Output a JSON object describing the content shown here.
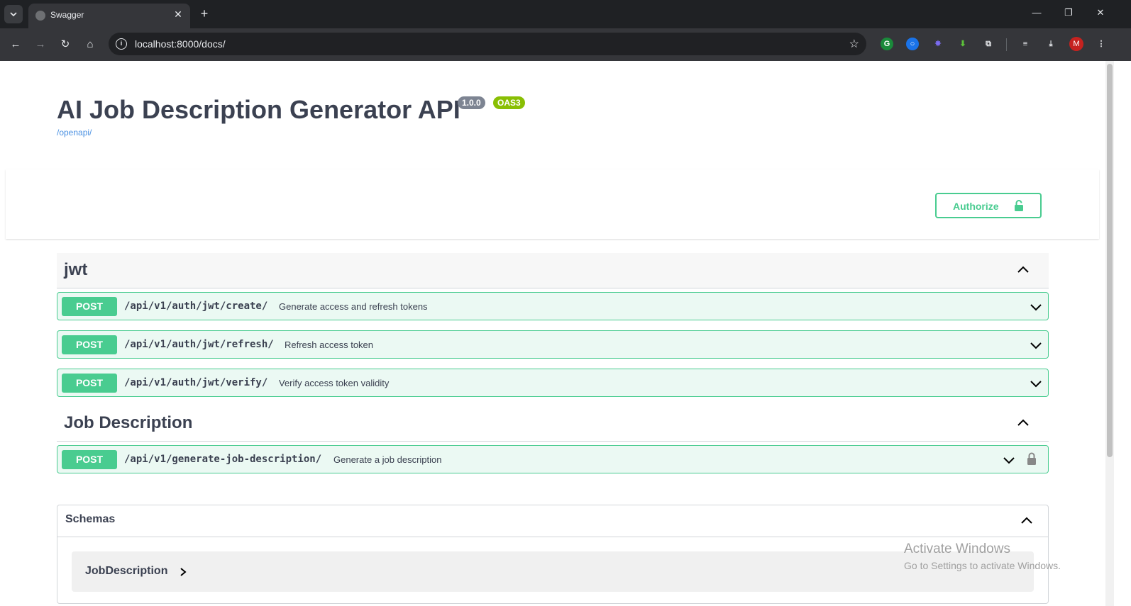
{
  "browser": {
    "tab_title": "Swagger",
    "url": "localhost:8000/docs/",
    "profile_initial": "M",
    "tab_search_icon": "chevron-down-icon",
    "extensions": [
      "grammarly-icon",
      "blue-circle-extension-icon",
      "purple-star-extension-icon",
      "green-download-extension-icon",
      "puzzle-icon"
    ]
  },
  "info": {
    "title": "AI Job Description Generator API",
    "version": "1.0.0",
    "oas": "OAS3",
    "spec_link": "/openapi/"
  },
  "auth": {
    "authorize_label": "Authorize"
  },
  "tags": [
    {
      "name": "jwt",
      "operations": [
        {
          "method": "POST",
          "path": "/api/v1/auth/jwt/create/",
          "summary": "Generate access and refresh tokens",
          "locked": false
        },
        {
          "method": "POST",
          "path": "/api/v1/auth/jwt/refresh/",
          "summary": "Refresh access token",
          "locked": false
        },
        {
          "method": "POST",
          "path": "/api/v1/auth/jwt/verify/",
          "summary": "Verify access token validity",
          "locked": false
        }
      ]
    },
    {
      "name": "Job Description",
      "operations": [
        {
          "method": "POST",
          "path": "/api/v1/generate-job-description/",
          "summary": "Generate a job description",
          "locked": true
        }
      ]
    }
  ],
  "schemas": {
    "title": "Schemas",
    "items": [
      "JobDescription"
    ]
  },
  "watermark": {
    "title": "Activate Windows",
    "subtitle": "Go to Settings to activate Windows."
  },
  "colors": {
    "post": "#49cc90",
    "post_bg": "#ebf9f3",
    "text": "#3b4151",
    "link": "#4990e2",
    "badge_version": "#7d8492",
    "badge_oas": "#89bf04"
  }
}
